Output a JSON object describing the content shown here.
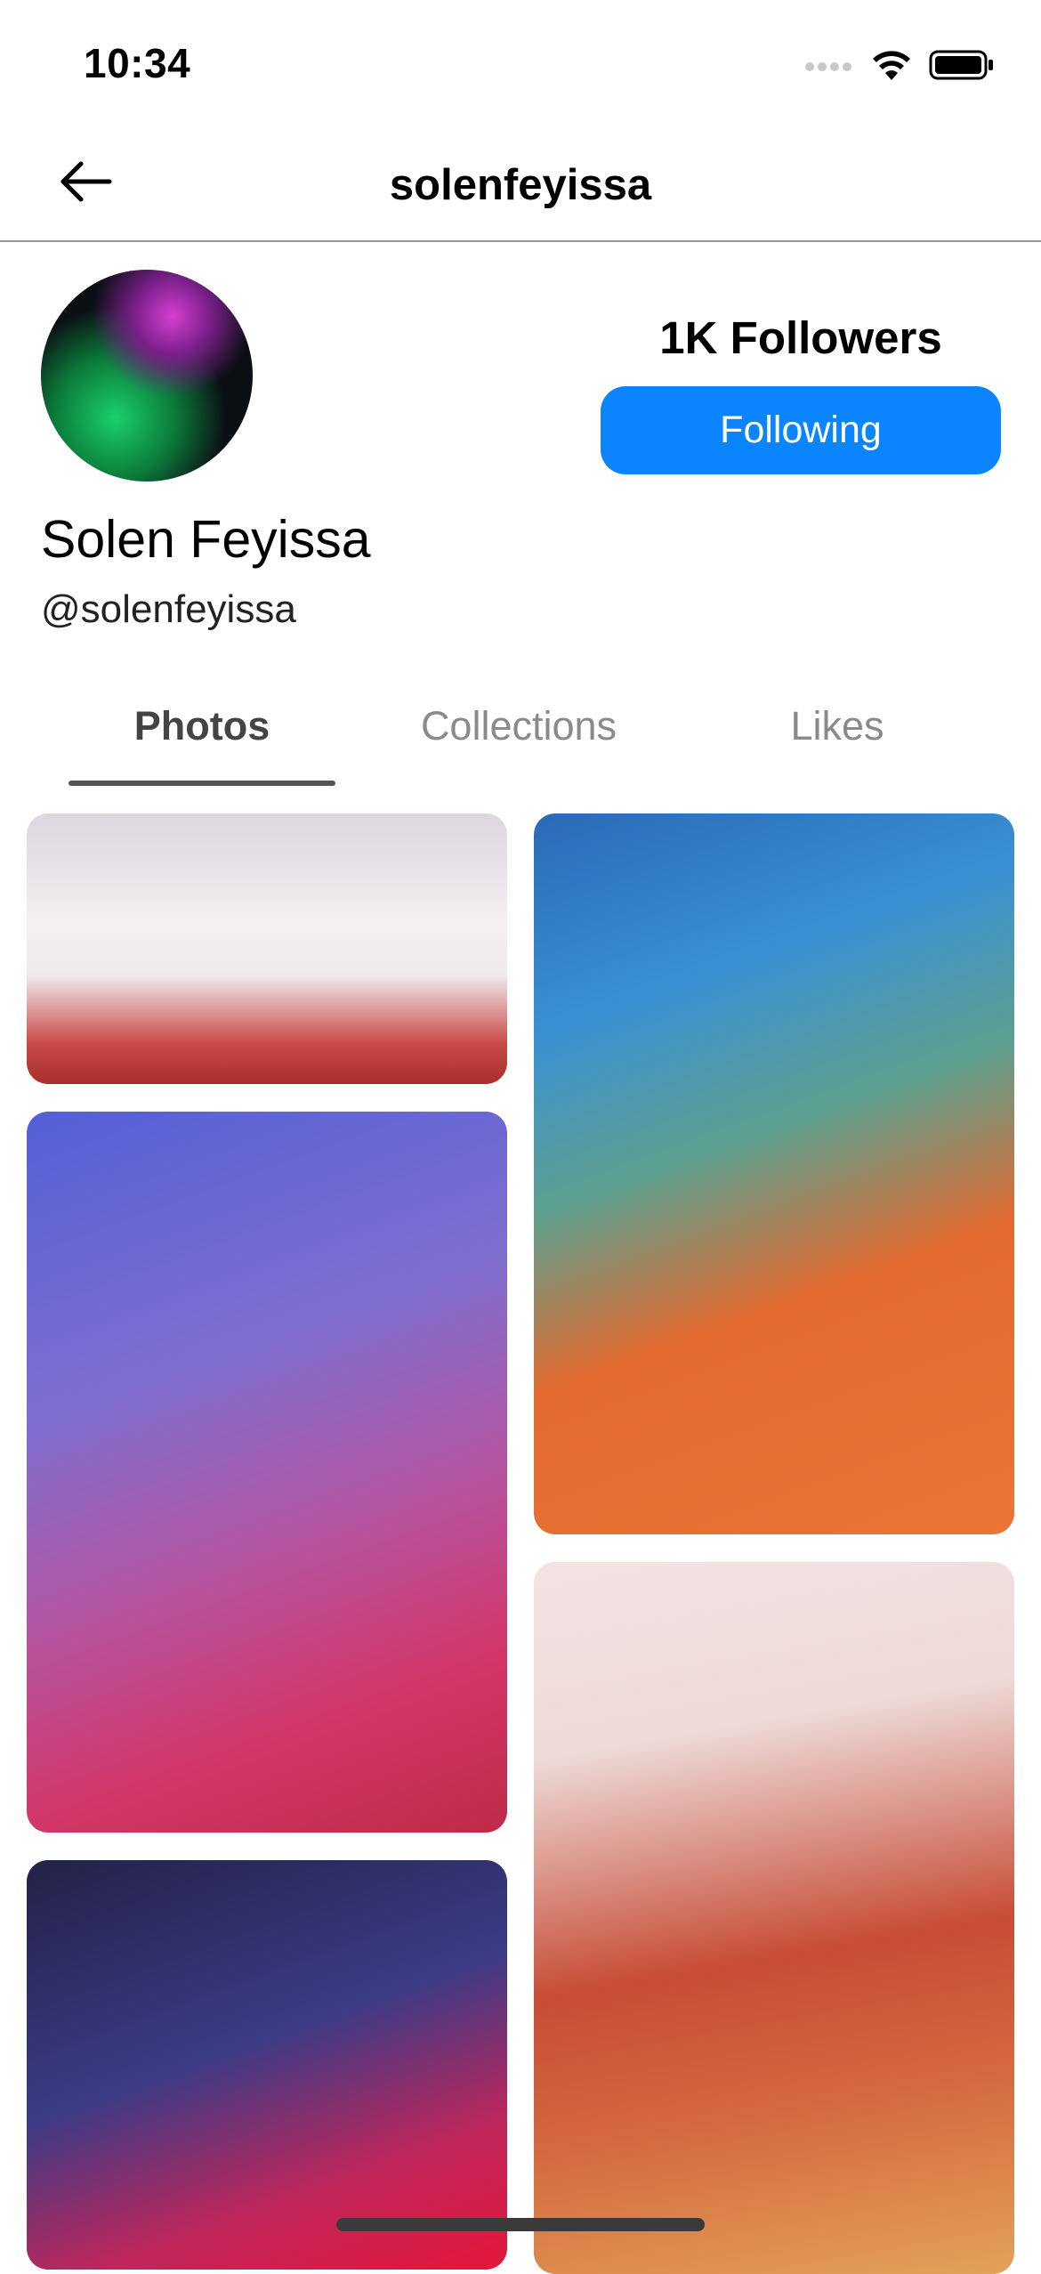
{
  "status_bar": {
    "time": "10:34",
    "icons": [
      "signal-icon",
      "wifi-icon",
      "battery-icon"
    ]
  },
  "nav": {
    "title": "solenfeyissa",
    "back_icon": "back-arrow-icon"
  },
  "profile": {
    "followers": "1K Followers",
    "follow_button": "Following",
    "display_name": "Solen Feyissa",
    "username": "@solenfeyissa"
  },
  "tabs": [
    {
      "label": "Photos",
      "active": true
    },
    {
      "label": "Collections",
      "active": false
    },
    {
      "label": "Likes",
      "active": false
    }
  ],
  "photos": [
    {
      "column": "left",
      "description_icon": "photo"
    },
    {
      "column": "left",
      "description_icon": "photo"
    },
    {
      "column": "left",
      "description_icon": "photo"
    },
    {
      "column": "right",
      "description_icon": "photo"
    },
    {
      "column": "right",
      "description_icon": "photo"
    }
  ],
  "colors": {
    "accent": "#0a84ff",
    "tab_active": "#444444",
    "tab_inactive": "#8a8a8a"
  }
}
